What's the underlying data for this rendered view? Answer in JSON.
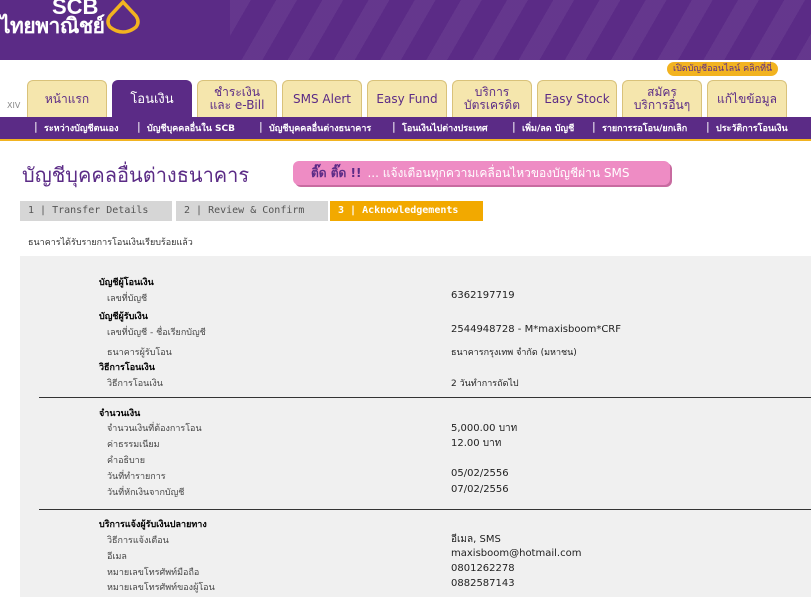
{
  "brand": {
    "name_en": "SCB",
    "name_th": "ไทยพาณิชย์",
    "color_primary": "#5b2b86",
    "color_accent": "#f2b320"
  },
  "header": {
    "open_account": "เปิดบัญชีออนไลน์ คลิกที่นี่",
    "version": "XIV"
  },
  "tabs": [
    {
      "label": "หน้าแรก"
    },
    {
      "label": "โอนเงิน",
      "active": true
    },
    {
      "label": "ชำระเงิน\nและ e-Bill"
    },
    {
      "label": "SMS Alert"
    },
    {
      "label": "Easy Fund"
    },
    {
      "label": "บริการ\nบัตรเครดิต"
    },
    {
      "label": "Easy Stock"
    },
    {
      "label": "สมัคร\nบริการอื่นๆ"
    },
    {
      "label": "แก้ไขข้อมูล"
    }
  ],
  "subnav": [
    "ระหว่างบัญชีตนเอง",
    "บัญชีบุคคลอื่นใน SCB",
    "บัญชีบุคคลอื่นต่างธนาคาร",
    "โอนเงินไปต่างประเทศ",
    "เพิ่ม/ลด บัญชี",
    "รายการรอโอน/ยกเลิก",
    "ประวัติการโอนเงิน"
  ],
  "page": {
    "title": "บัญชีบุคคลอื่นต่างธนาคาร",
    "promo_highlight": "ติ๊ด ติ๊ด !!",
    "promo_text": "... แจ้งเตือนทุกความเคลื่อนไหวของบัญชีผ่าน SMS",
    "confirm_message": "ธนาคารได้รับรายการโอนเงินเรียบร้อยแล้ว"
  },
  "steps": [
    {
      "label": "1 | Transfer Details"
    },
    {
      "label": "2 | Review & Confirm"
    },
    {
      "label": "3 | Acknowledgements",
      "active": true
    }
  ],
  "details": {
    "from_title": "บัญชีผู้โอนเงิน",
    "from_account_label": "เลขที่บัญชี",
    "from_account_value": "6362197719",
    "to_title": "บัญชีผู้รับเงิน",
    "to_account_label": "เลขที่บัญชี - ชื่อเรียกบัญชี",
    "to_account_value": "2544948728 - M*maxisboom*CRF",
    "to_bank_label": "ธนาคารผู้รับโอน",
    "to_bank_value": "ธนาคารกรุงเทพ จำกัด (มหาชน)",
    "method_title": "วิธีการโอนเงิน",
    "method_label": "วิธีการโอนเงิน",
    "method_value": "2 วันทำการถัดไป",
    "amount_title": "จำนวนเงิน",
    "amount_label": "จำนวนเงินที่ต้องการโอน",
    "amount_value": "5,000.00 บาท",
    "fee_label": "ค่าธรรมเนียม",
    "fee_value": "12.00 บาท",
    "desc_label": "คำอธิบาย",
    "desc_value": "",
    "txn_date_label": "วันที่ทำรายการ",
    "txn_date_value": "05/02/2556",
    "debit_date_label": "วันที่หักเงินจากบัญชี",
    "debit_date_value": "07/02/2556",
    "notify_title": "บริการแจ้งผู้รับเงินปลายทาง",
    "notify_method_label": "วิธีการแจ้งเตือน",
    "notify_method_value": "อีเมล, SMS",
    "email_label": "อีเมล",
    "email_value": "maxisboom@hotmail.com",
    "mobile_label": "หมายเลขโทรศัพท์มือถือ",
    "mobile_value": "0801262278",
    "sender_phone_label": "หมายเลขโทรศัพท์ของผู้โอน",
    "sender_phone_value": "0882587143"
  }
}
